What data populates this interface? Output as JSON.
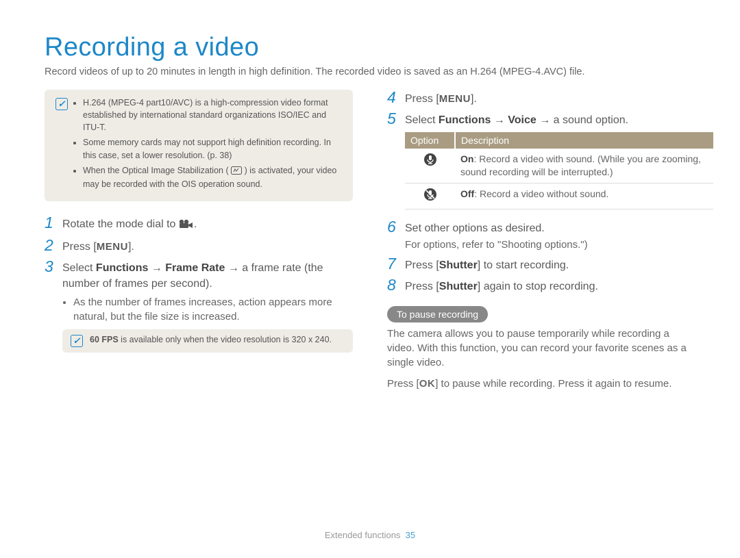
{
  "title": "Recording a video",
  "intro": "Record videos of up to 20 minutes in length in high definition. The recorded video is saved as an H.264 (MPEG-4.AVC) file.",
  "notebox": {
    "b1": "H.264 (MPEG-4 part10/AVC) is a high-compression video format established by international standard organizations ISO/IEC and ITU-T.",
    "b2": "Some memory cards may not support high definition recording. In this case, set a lower resolution. (p. 38)",
    "b3a": "When the Optical Image Stabilization (",
    "b3b": ") is activated, your video may be recorded with the OIS operation sound."
  },
  "left": {
    "s1": "Rotate the mode dial to ",
    "s1_end": ".",
    "s2a": "Press [",
    "menu": "MENU",
    "s2b": "].",
    "s3a": "Select ",
    "s3_functions": "Functions",
    "s3_arrow": " → ",
    "s3_framerate": "Frame Rate",
    "s3b": " → a frame rate (the number of frames per second).",
    "s3_bullet": "As the number of frames increases, action appears more natural, but the file size is increased.",
    "fps_note_bold": "60 FPS",
    "fps_note_rest": " is available only when the video resolution is 320 x 240."
  },
  "right": {
    "s4a": "Press [",
    "menu": "MENU",
    "s4b": "].",
    "s5a": "Select ",
    "s5_functions": "Functions",
    "arrow": " → ",
    "s5_voice": "Voice",
    "s5b": " → a sound option.",
    "table": {
      "h_option": "Option",
      "h_desc": "Description",
      "on_label": "On",
      "on_text": ": Record a video with sound. (While you are zooming, sound recording will be interrupted.)",
      "off_label": "Off",
      "off_text": ": Record a video without sound."
    },
    "s6a": "Set other options as desired.",
    "s6b": "For options, refer to \"Shooting options.\")",
    "s7a": "Press [",
    "s7_shutter": "Shutter",
    "s7b": "] to start recording.",
    "s8a": "Press [",
    "s8_shutter": "Shutter",
    "s8b": "] again to stop recording.",
    "pause_heading": "To pause recording",
    "pause_p1": "The camera allows you to pause temporarily while recording a video. With this function, you can record your favorite scenes as a single video.",
    "pause_p2a": "Press [",
    "ok": "OK",
    "pause_p2b": "] to pause while recording. Press it again to resume."
  },
  "footer": {
    "section": "Extended functions",
    "page": "35"
  }
}
